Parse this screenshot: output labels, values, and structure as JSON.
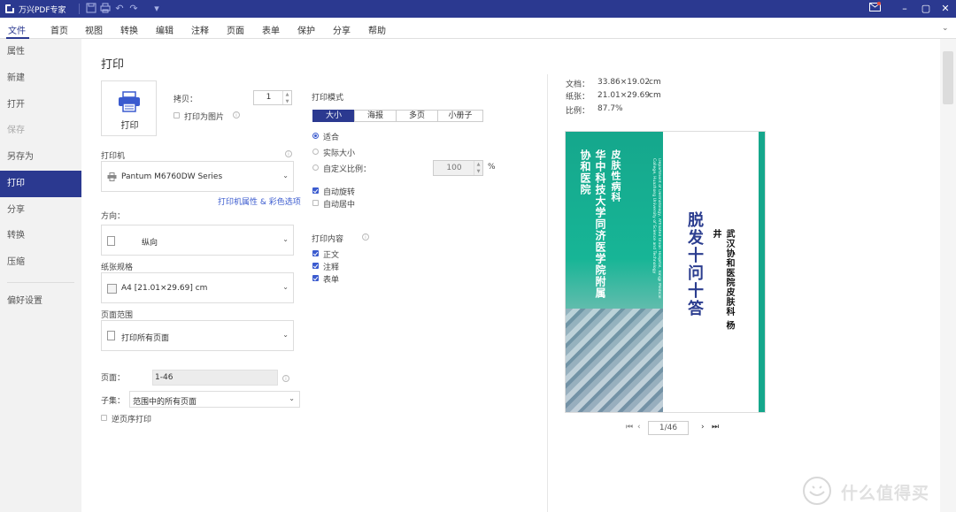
{
  "app": {
    "title": "万兴PDF专家"
  },
  "menu": {
    "items": [
      "文件",
      "首页",
      "视图",
      "转换",
      "编辑",
      "注释",
      "页面",
      "表单",
      "保护",
      "分享",
      "帮助"
    ],
    "active": "文件"
  },
  "sidebar": {
    "items": [
      {
        "label": "属性",
        "state": "normal"
      },
      {
        "label": "新建",
        "state": "normal"
      },
      {
        "label": "打开",
        "state": "normal"
      },
      {
        "label": "保存",
        "state": "disabled"
      },
      {
        "label": "另存为",
        "state": "normal"
      },
      {
        "label": "打印",
        "state": "active"
      },
      {
        "label": "分享",
        "state": "normal"
      },
      {
        "label": "转换",
        "state": "normal"
      },
      {
        "label": "压缩",
        "state": "normal"
      },
      {
        "label": "偏好设置",
        "state": "normal"
      }
    ]
  },
  "print": {
    "heading": "打印",
    "print_button": "打印",
    "copies_label": "拷贝：",
    "copies_value": "1",
    "print_as_image": "打印为图片",
    "printer_label": "打印机",
    "printer_value": "Pantum M6760DW Series",
    "printer_props_link": "打印机属性 & 彩色选项",
    "orientation_label": "方向：",
    "orientation_value": "纵向",
    "paper_label": "纸张规格",
    "paper_value": "A4  [21.01×29.69] cm",
    "range_label": "页面范围",
    "range_value": "打印所有页面",
    "pages_label": "页面：",
    "pages_value": "1-46",
    "subset_label": "子集：",
    "subset_value": "范围中的所有页面",
    "reverse_label": "逆页序打印",
    "mode_label": "打印模式",
    "mode_tabs": [
      "大小",
      "海报",
      "多页",
      "小册子"
    ],
    "mode_active": "大小",
    "fit": "适合",
    "actual_size": "实际大小",
    "custom_scale": "自定义比例：",
    "custom_scale_value": "100",
    "percent": "%",
    "auto_rotate": "自动旋转",
    "auto_center": "自动居中",
    "content_label": "打印内容",
    "content_items": [
      "正文",
      "注释",
      "表单"
    ]
  },
  "preview": {
    "doc_label": "文档：",
    "doc_value": "33.86×19.02",
    "doc_unit": "cm",
    "paper_label": "纸张：",
    "paper_value": "21.01×29.69",
    "paper_unit": "cm",
    "scale_label": "比例：",
    "scale_value": "87.7%",
    "page_indicator": "1/46",
    "slide": {
      "institution": "华中科技大学同济医学院附属协和医院",
      "department": "皮肤性病科",
      "institution_en": "Department of Dermatology, Affiliated Union Hospital, Tongji Medical College, Huazhong University of Science and Technology",
      "title": "脱发十问十答",
      "author": "武汉协和医院皮肤科   杨井"
    }
  },
  "watermark": {
    "text": "什么值得买"
  },
  "colors": {
    "brand": "#2b3990",
    "accent": "#3b5bcf",
    "teal": "#1aa88e"
  }
}
